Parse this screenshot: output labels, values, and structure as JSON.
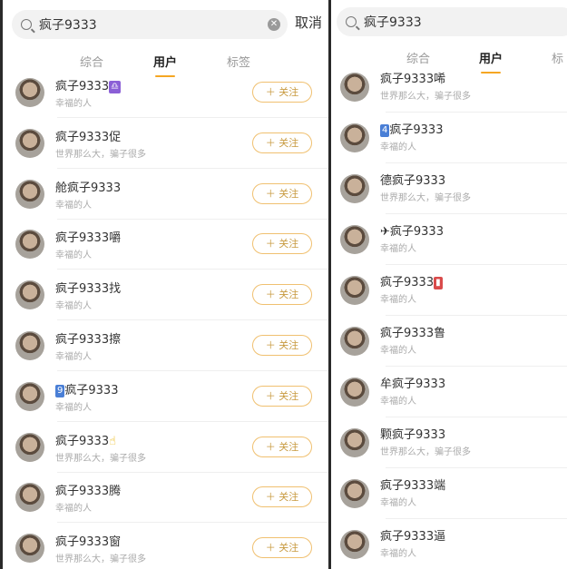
{
  "left": {
    "search": {
      "query": "疯子9333"
    },
    "cancel_label": "取消",
    "tabs": [
      {
        "label": "综合"
      },
      {
        "label": "用户"
      },
      {
        "label": "标签"
      }
    ],
    "follow_label": "＋ 关注",
    "users": [
      {
        "name": "疯子9333",
        "badge": "♎",
        "bio": "幸福的人"
      },
      {
        "name": "疯子9333促",
        "bio": "世界那么大，骗子很多"
      },
      {
        "name": "舱疯子9333",
        "bio": "幸福的人"
      },
      {
        "name": "疯子9333嚼",
        "bio": "幸福的人"
      },
      {
        "name": "疯子9333找",
        "bio": "幸福的人"
      },
      {
        "name": "疯子9333擦",
        "bio": "幸福的人"
      },
      {
        "name": "疯子9333",
        "badge_prefix": "9",
        "bio": "幸福的人"
      },
      {
        "name": "疯子9333",
        "emoji": "☝",
        "bio": "世界那么大，骗子很多"
      },
      {
        "name": "疯子9333腾",
        "bio": "幸福的人"
      },
      {
        "name": "疯子9333窗",
        "bio": "世界那么大，骗子很多"
      }
    ]
  },
  "right": {
    "search": {
      "query": "疯子9333"
    },
    "tabs": [
      {
        "label": "综合"
      },
      {
        "label": "用户"
      },
      {
        "label": "标"
      }
    ],
    "users": [
      {
        "name": "疯子9333唏",
        "bio": "世界那么大，骗子很多"
      },
      {
        "name": "疯子9333",
        "badge_prefix": "4",
        "bio": "幸福的人"
      },
      {
        "name": "德疯子9333",
        "bio": "世界那么大，骗子很多"
      },
      {
        "name": "✈疯子9333",
        "bio": "幸福的人"
      },
      {
        "name": "疯子9333",
        "badge": "▮",
        "bio": "幸福的人"
      },
      {
        "name": "疯子9333鲁",
        "bio": "幸福的人"
      },
      {
        "name": "牟疯子9333",
        "bio": "幸福的人"
      },
      {
        "name": "颗疯子9333",
        "bio": "世界那么大，骗子很多"
      },
      {
        "name": "疯子9333端",
        "bio": "幸福的人"
      },
      {
        "name": "疯子9333逼",
        "bio": "幸福的人"
      }
    ]
  }
}
